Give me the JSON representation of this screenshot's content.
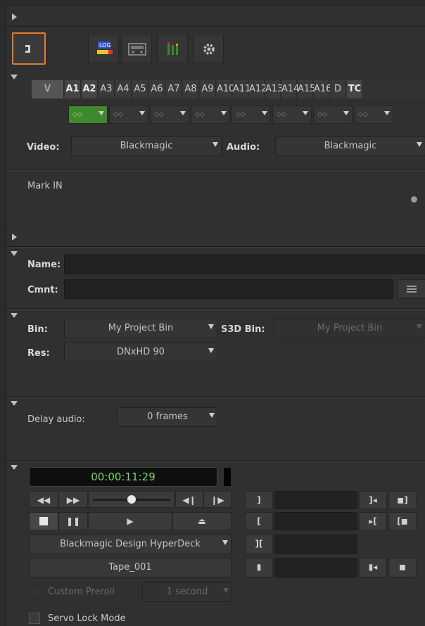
{
  "toolbar": {
    "tool_icons": [
      "mark-in-tool-icon",
      "log-icon",
      "tape-deck-icon",
      "audio-meter-icon",
      "gear-icon"
    ]
  },
  "tracks": {
    "labels": [
      "V",
      "A1",
      "A2",
      "A3",
      "A4",
      "A5",
      "A6",
      "A7",
      "A8",
      "A9",
      "A10",
      "A11",
      "A12",
      "A13",
      "A14",
      "A15",
      "A16",
      "D",
      "TC"
    ],
    "selected": [
      "A1",
      "A2",
      "TC"
    ],
    "monitor_glyphs": [
      "◇◇",
      "◇◇",
      "◇◇",
      "◇◇",
      "◇◇",
      "◇◇",
      "◇◇",
      "◇◇"
    ],
    "accent_active": "#3f8a2e"
  },
  "io": {
    "video_label": "Video:",
    "video_value": "Blackmagic",
    "audio_label": "Audio:",
    "audio_value": "Blackmagic"
  },
  "mark": {
    "text": "Mark IN"
  },
  "clip": {
    "name_label": "Name:",
    "name_value": "",
    "comment_label": "Cmnt:",
    "comment_value": ""
  },
  "bin": {
    "bin_label": "Bin:",
    "bin_value": "My Project Bin",
    "s3d_label": "S3D Bin:",
    "s3d_value": "My Project Bin",
    "res_label": "Res:",
    "res_value": "DNxHD 90"
  },
  "delay": {
    "label": "Delay audio:",
    "value": "0 frames"
  },
  "deck": {
    "timecode": "00:00:11:29",
    "timecode_color": "#7bd46a",
    "device": "Blackmagic Design HyperDeck",
    "tape": "Tape_001",
    "custom_preroll_label": "Custom Preroll",
    "custom_preroll_checked": false,
    "preroll_value": "1 second",
    "servo_label": "Servo Lock Mode",
    "servo_checked": false,
    "shuttle_level": 0.55
  }
}
